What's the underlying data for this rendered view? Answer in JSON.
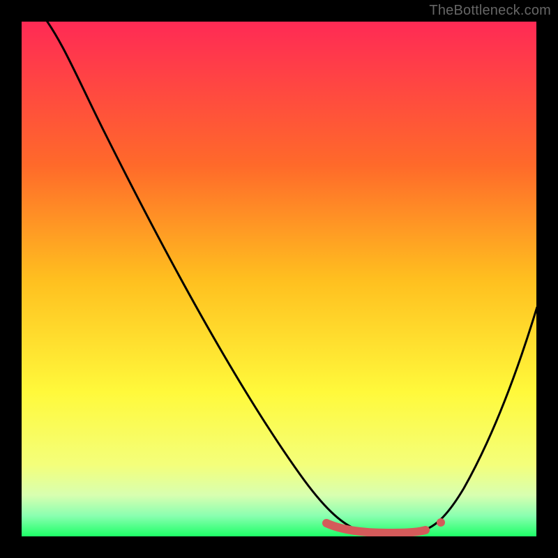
{
  "watermark": "TheBottleneck.com",
  "chart_data": {
    "type": "line",
    "title": "",
    "xlabel": "",
    "ylabel": "",
    "xlim": [
      0,
      100
    ],
    "ylim": [
      0,
      100
    ],
    "background_gradient_colors": {
      "top": "#ff2a55",
      "upper_mid": "#ffbf1f",
      "lower_mid": "#f8ff4a",
      "near_bottom": "#b6ffb6",
      "bottom": "#1dff67"
    },
    "black_border_px": 31,
    "series": [
      {
        "name": "curve",
        "x": [
          4,
          10,
          20,
          30,
          40,
          50,
          55,
          60,
          63,
          66,
          70,
          73,
          76,
          80,
          85,
          90,
          96
        ],
        "y": [
          100,
          92,
          78,
          64,
          50,
          36,
          29,
          20,
          12,
          5,
          1,
          0,
          0,
          1,
          10,
          25,
          47
        ],
        "stroke": "#000000"
      },
      {
        "name": "highlight-band",
        "note": "flat red segment near minimum of curve",
        "x_range": [
          59,
          80
        ],
        "color": "#d45a5a"
      }
    ]
  }
}
